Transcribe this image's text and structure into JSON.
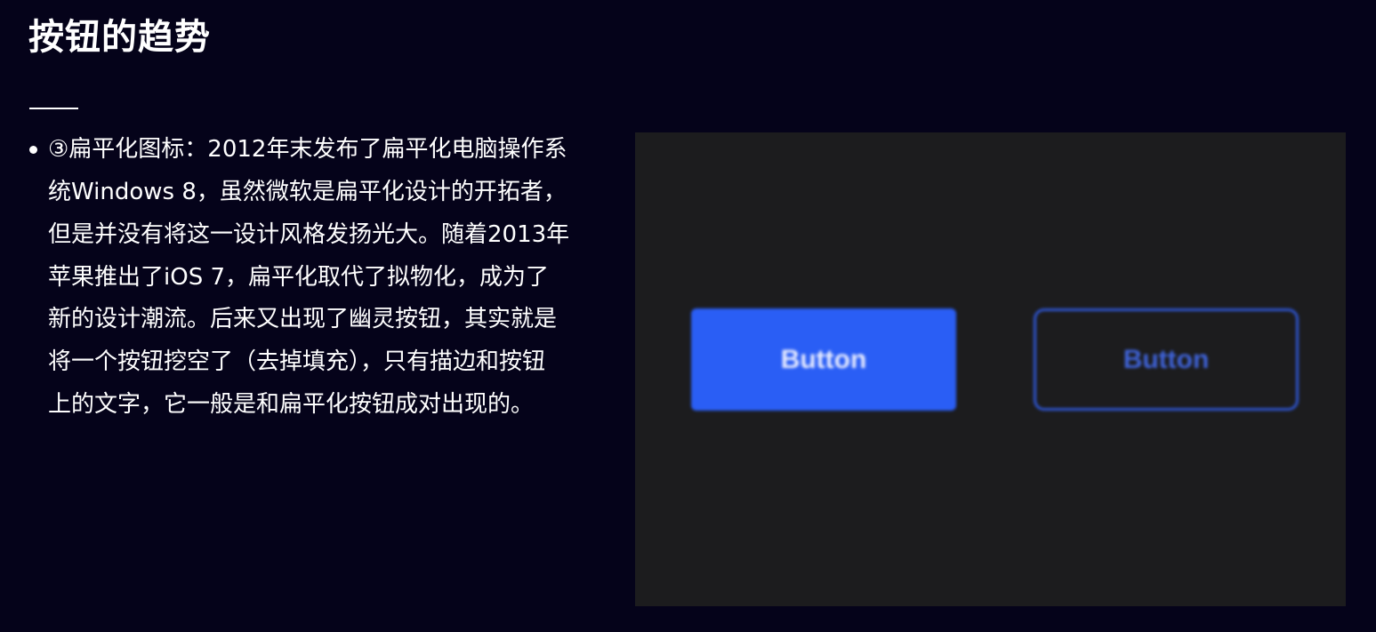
{
  "slide": {
    "title": "按钮的趋势",
    "bullet_lines": [
      "③扁平化图标：2012年末发布了扁平化电脑操作系",
      "统Windows  8，虽然微软是扁平化设计的开拓者，",
      "但是并没有将这一设计风格发扬光大。随着2013年",
      "苹果推出了iOS   7，扁平化取代了拟物化，成为了",
      "新的设计潮流。后来又出现了幽灵按钮，其实就是",
      "将一个按钮挖空了（去掉填充），只有描边和按钮",
      "上的文字，它一般是和扁平化按钮成对出现的。"
    ]
  },
  "demo": {
    "flat_button_label": "Button",
    "ghost_button_label": "Button",
    "colors": {
      "background": "#05031a",
      "panel": "#1c1c1e",
      "flat_fill": "#2a5ef5",
      "ghost_stroke": "#2e55d1"
    }
  }
}
